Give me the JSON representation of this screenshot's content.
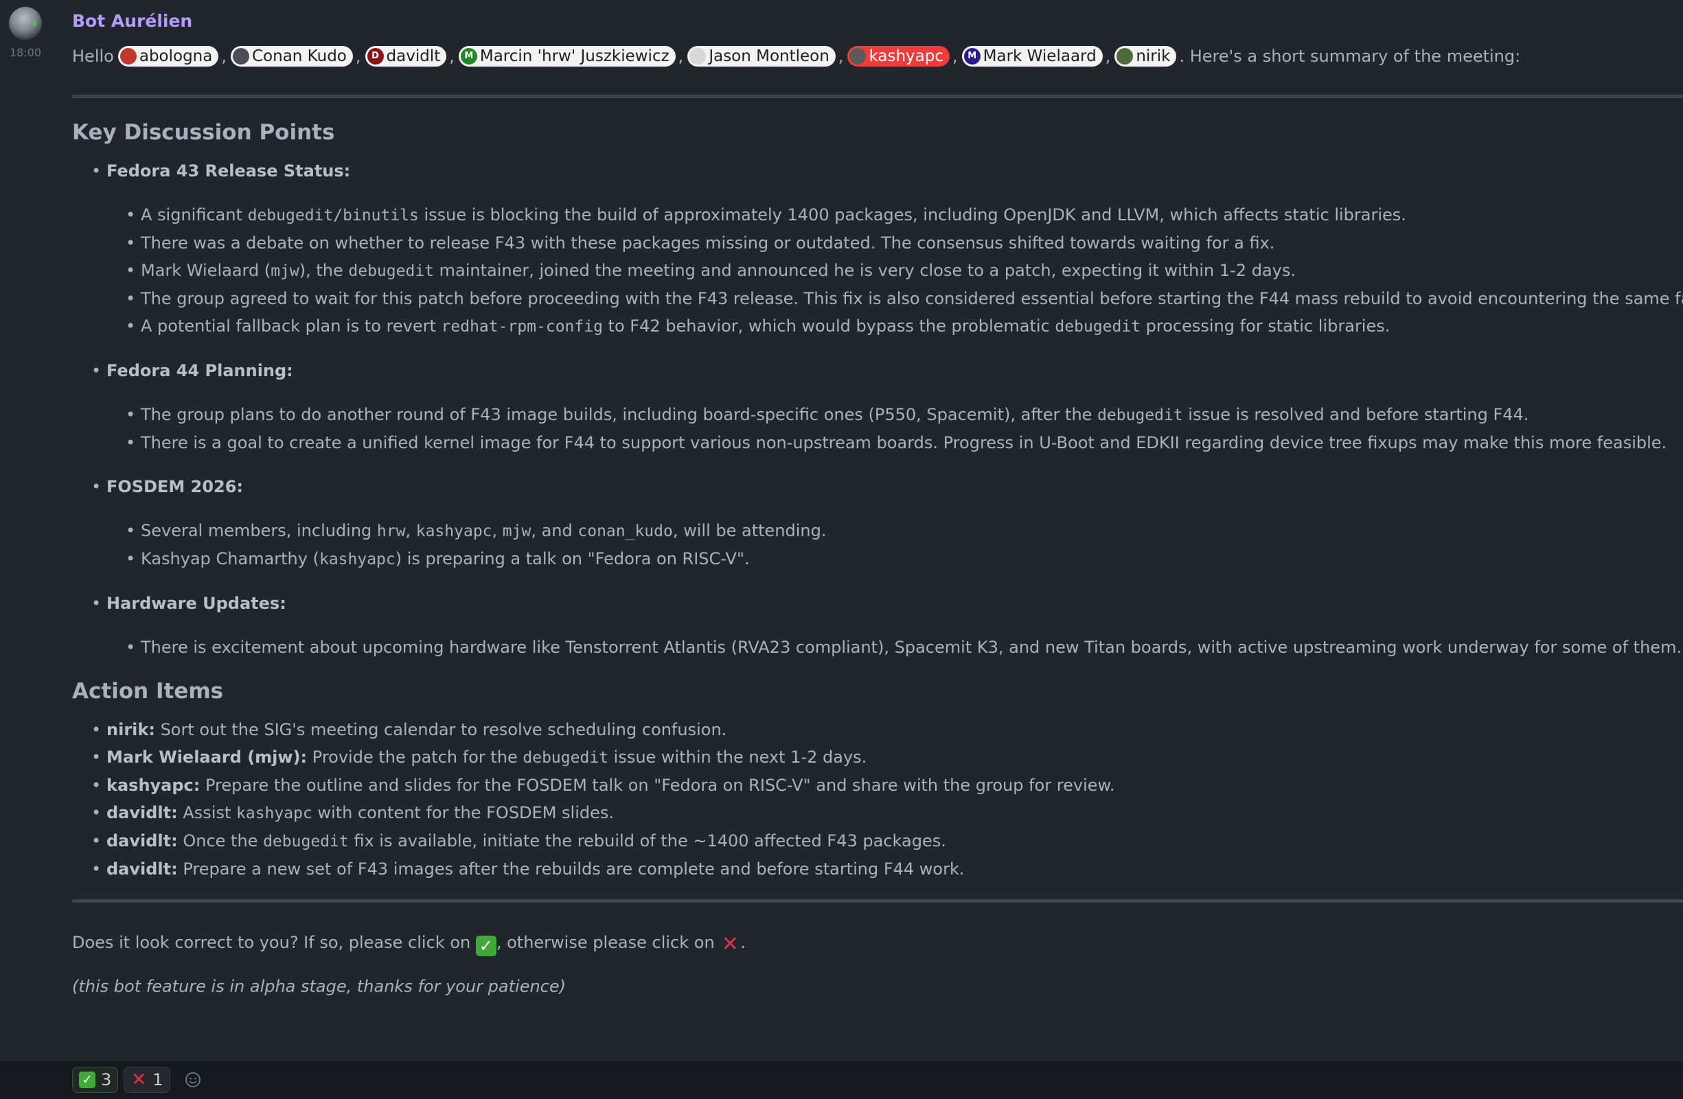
{
  "message": {
    "sender": "Bot Aurélien",
    "time": "18:00",
    "greeting": "Hello",
    "mentions": [
      {
        "name": "abologna",
        "color": "#c0392b",
        "initial": ""
      },
      {
        "name": "Conan Kudo",
        "color": "#4a4f57",
        "initial": ""
      },
      {
        "name": "davidlt",
        "color": "#8b1414",
        "initial": "D"
      },
      {
        "name": "Marcin 'hrw' Juszkiewicz",
        "color": "#1f8a24",
        "initial": "M"
      },
      {
        "name": "Jason Montleon",
        "color": "#d8d8d8",
        "initial": ""
      },
      {
        "name": "kashyapc",
        "color": "#5a5a5a",
        "initial": ""
      },
      {
        "name": "Mark Wielaard",
        "color": "#2d1a8c",
        "initial": "M"
      },
      {
        "name": "nirik",
        "color": "#4f6a3a",
        "initial": ""
      }
    ],
    "greeting_tail": ". Here's a short summary of the meeting:",
    "heading_discussion": "Key Discussion Points",
    "f43_title": "Fedora 43 Release Status:",
    "f43_1a": "A significant ",
    "f43_1code": "debugedit/binutils",
    "f43_1b": " issue is blocking the build of approximately 1400 packages, including OpenJDK and LLVM, which affects static libraries.",
    "f43_2": "There was a debate on whether to release F43 with these packages missing or outdated. The consensus shifted towards waiting for a fix.",
    "f43_3a": "Mark Wielaard (",
    "f43_3code1": "mjw",
    "f43_3b": "), the ",
    "f43_3code2": "debugedit",
    "f43_3c": " maintainer, joined the meeting and announced he is very close to a patch, expecting it within 1-2 days.",
    "f43_4": "The group agreed to wait for this patch before proceeding with the F43 release. This fix is also considered essential before starting the F44 mass rebuild to avoid encountering the same failures.",
    "f43_5a": "A potential fallback plan is to revert ",
    "f43_5code1": "redhat-rpm-config",
    "f43_5b": " to F42 behavior, which would bypass the problematic ",
    "f43_5code2": "debugedit",
    "f43_5c": " processing for static libraries.",
    "f44_title": "Fedora 44 Planning:",
    "f44_1a": "The group plans to do another round of F43 image builds, including board-specific ones (P550, Spacemit), after the ",
    "f44_1code": "debugedit",
    "f44_1b": " issue is resolved and before starting F44.",
    "f44_2": "There is a goal to create a unified kernel image for F44 to support various non-upstream boards. Progress in U-Boot and EDKII regarding device tree fixups may make this more feasible.",
    "fosdem_title": "FOSDEM 2026:",
    "fosdem_1a": "Several members, including ",
    "fosdem_1c1": "hrw",
    "fosdem_1s1": ", ",
    "fosdem_1c2": "kashyapc",
    "fosdem_1s2": ", ",
    "fosdem_1c3": "mjw",
    "fosdem_1s3": ", and ",
    "fosdem_1c4": "conan_kudo",
    "fosdem_1b": ", will be attending.",
    "fosdem_2a": "Kashyap Chamarthy (",
    "fosdem_2code": "kashyapc",
    "fosdem_2b": ") is preparing a talk on \"Fedora on RISC-V\".",
    "hw_title": "Hardware Updates:",
    "hw_1": "There is excitement about upcoming hardware like Tenstorrent Atlantis (RVA23 compliant), Spacemit K3, and new Titan boards, with active upstreaming work underway for some of them.",
    "heading_actions": "Action Items",
    "a1_who": "nirik:",
    "a1": " Sort out the SIG's meeting calendar to resolve scheduling confusion.",
    "a2_who": "Mark Wielaard (mjw):",
    "a2a": " Provide the patch for the ",
    "a2code": "debugedit",
    "a2b": " issue within the next 1-2 days.",
    "a3_who": "kashyapc:",
    "a3": " Prepare the outline and slides for the FOSDEM talk on \"Fedora on RISC-V\" and share with the group for review.",
    "a4_who": "davidlt:",
    "a4a": " Assist ",
    "a4code": "kashyapc",
    "a4b": " with content for the FOSDEM slides.",
    "a5_who": "davidlt:",
    "a5a": " Once the ",
    "a5code": "debugedit",
    "a5b": " fix is available, initiate the rebuild of the ~1400 affected F43 packages.",
    "a6_who": "davidlt:",
    "a6": " Prepare a new set of F43 images after the rebuilds are complete and before starting F44 work.",
    "confirm_a": "Does it look correct to you? If so, please click on ",
    "confirm_b": ", otherwise please click on ",
    "confirm_c": ".",
    "alpha_note": "(this bot feature is in alpha stage, thanks for your patience)"
  },
  "reactions": [
    {
      "emoji": "check-mark",
      "count": "3"
    },
    {
      "emoji": "cross-mark",
      "count": "1"
    }
  ],
  "colors": {
    "sender": "#b39cff",
    "background": "#21262c",
    "own_mention": "#ef3b3b"
  }
}
